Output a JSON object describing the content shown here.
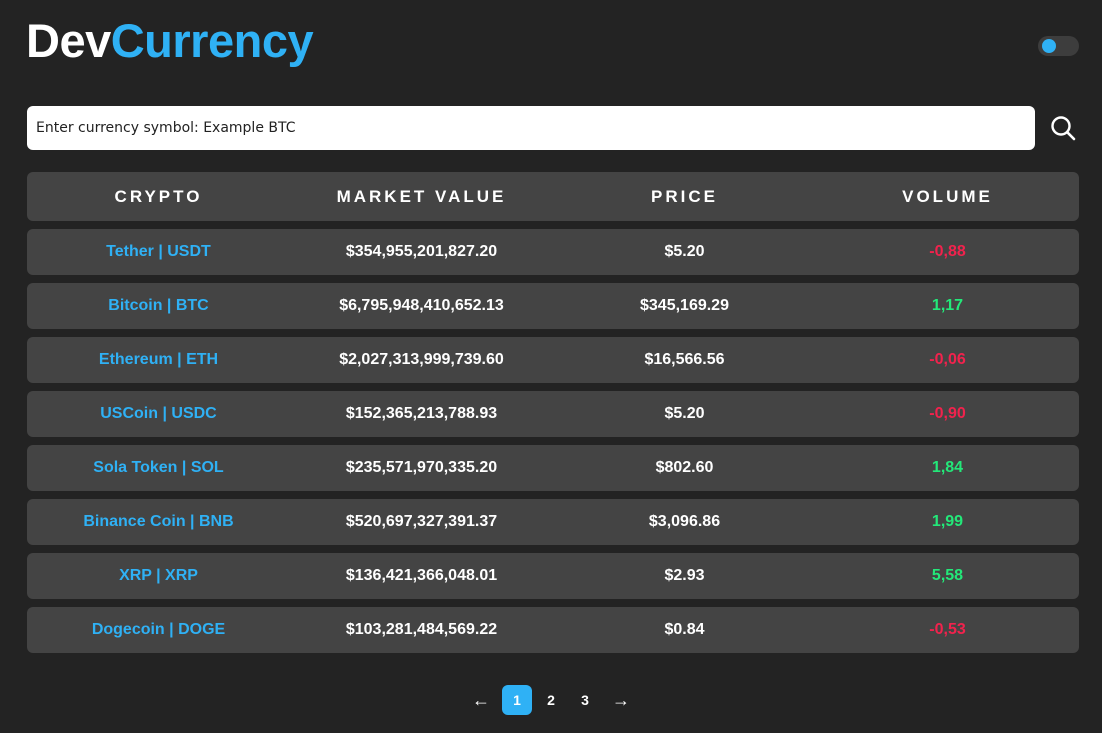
{
  "header": {
    "logo_dev": "Dev",
    "logo_currency": "Currency"
  },
  "theme_toggle": {
    "state": "on",
    "accent": "#2fb1f5"
  },
  "search": {
    "placeholder": "Enter currency symbol: Example BTC",
    "value": "",
    "icon": "search-icon"
  },
  "table": {
    "columns": [
      "CRYPTO",
      "MARKET VALUE",
      "PRICE",
      "VOLUME"
    ],
    "rows": [
      {
        "name": "Tether | USDT",
        "market_value": "$354,955,201,827.20",
        "price": "$5.20",
        "volume": "-0,88",
        "trend": "negative"
      },
      {
        "name": "Bitcoin | BTC",
        "market_value": "$6,795,948,410,652.13",
        "price": "$345,169.29",
        "volume": "1,17",
        "trend": "positive"
      },
      {
        "name": "Ethereum | ETH",
        "market_value": "$2,027,313,999,739.60",
        "price": "$16,566.56",
        "volume": "-0,06",
        "trend": "negative"
      },
      {
        "name": "USCoin | USDC",
        "market_value": "$152,365,213,788.93",
        "price": "$5.20",
        "volume": "-0,90",
        "trend": "negative"
      },
      {
        "name": "Sola Token | SOL",
        "market_value": "$235,571,970,335.20",
        "price": "$802.60",
        "volume": "1,84",
        "trend": "positive"
      },
      {
        "name": "Binance Coin | BNB",
        "market_value": "$520,697,327,391.37",
        "price": "$3,096.86",
        "volume": "1,99",
        "trend": "positive"
      },
      {
        "name": "XRP | XRP",
        "market_value": "$136,421,366,048.01",
        "price": "$2.93",
        "volume": "5,58",
        "trend": "positive"
      },
      {
        "name": "Dogecoin | DOGE",
        "market_value": "$103,281,484,569.22",
        "price": "$0.84",
        "volume": "-0,53",
        "trend": "negative"
      }
    ]
  },
  "pagination": {
    "prev": "←",
    "pages": [
      "1",
      "2",
      "3"
    ],
    "current": "1",
    "next": "→"
  },
  "colors": {
    "background": "#232323",
    "row_background": "#444444",
    "accent": "#2fb1f5",
    "negative": "#f2224d",
    "positive": "#23e879"
  }
}
